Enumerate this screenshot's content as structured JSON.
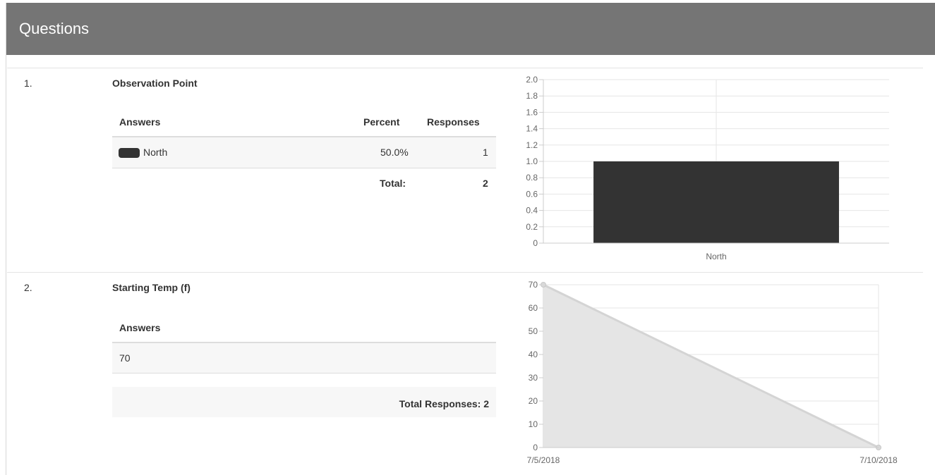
{
  "header": {
    "title": "Questions"
  },
  "questions": [
    {
      "number": "1.",
      "title": "Observation Point",
      "columns": {
        "answers": "Answers",
        "percent": "Percent",
        "responses": "Responses"
      },
      "rows": [
        {
          "answer": "North",
          "percent": "50.0%",
          "responses": "1",
          "swatch_color": "#333333"
        }
      ],
      "total_label": "Total:",
      "total_value": "2"
    },
    {
      "number": "2.",
      "title": "Starting Temp (f)",
      "columns": {
        "answers": "Answers"
      },
      "rows": [
        {
          "answer": "70"
        }
      ],
      "total_label": "Total Responses: 2"
    }
  ],
  "chart_data": [
    {
      "type": "bar",
      "categories": [
        "North"
      ],
      "values": [
        1.0
      ],
      "ylim": [
        0,
        2.0
      ],
      "yticks": [
        "0",
        "0.2",
        "0.4",
        "0.6",
        "0.8",
        "1.0",
        "1.2",
        "1.4",
        "1.6",
        "1.8",
        "2.0"
      ],
      "bar_color": "#333333",
      "grid": true
    },
    {
      "type": "area",
      "x": [
        "7/5/2018",
        "7/10/2018"
      ],
      "values": [
        70,
        0
      ],
      "ylim": [
        0,
        70
      ],
      "yticks": [
        "0",
        "10",
        "20",
        "30",
        "40",
        "50",
        "60",
        "70"
      ],
      "fill_color": "#e5e5e5",
      "line_color": "#d4d4d4",
      "grid": true
    }
  ]
}
